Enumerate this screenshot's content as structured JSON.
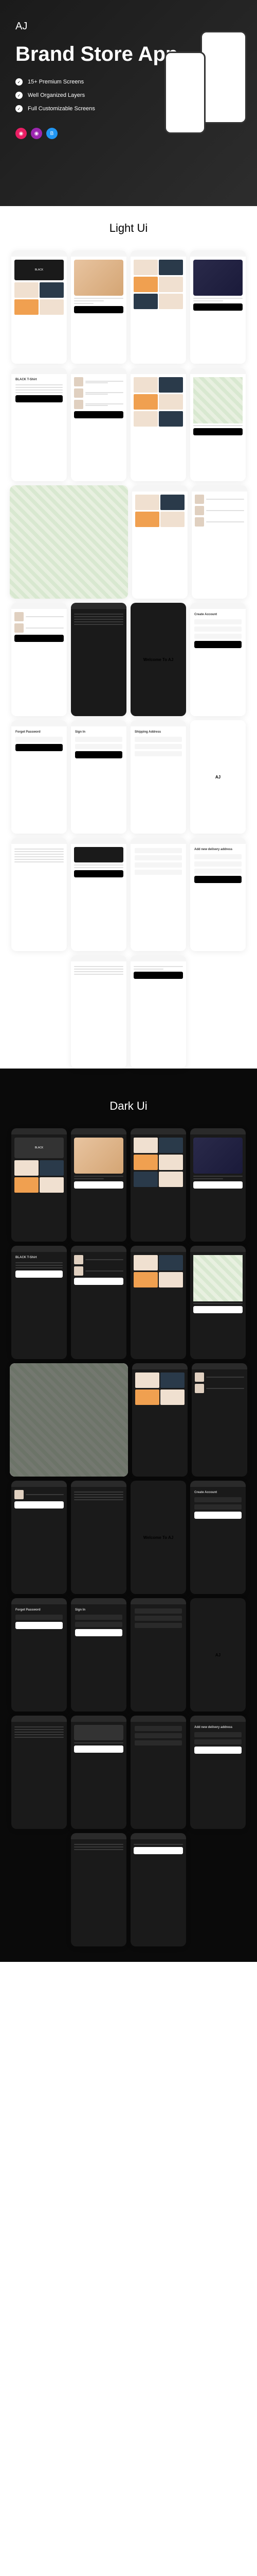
{
  "hero": {
    "logo": "AJ",
    "title": "Brand Store App",
    "features": [
      "15+ Premium Screens",
      "Well Organized Layers",
      "Full Customizable Screens"
    ]
  },
  "sections": {
    "light": "Light Ui",
    "dark": "Dark Ui"
  },
  "ui": {
    "banner": "BLACK",
    "welcome": "Welcome To AJ",
    "forgot": "Forget Password",
    "create": "Create Account",
    "signin": "Sign In",
    "product": "BLACK T-Shirt",
    "delivery": "Shipping Address",
    "addmore": "Add new delivery address"
  }
}
